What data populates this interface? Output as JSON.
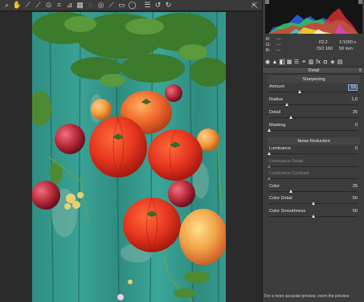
{
  "toolbar": {
    "tools": [
      "zoom-tool-icon",
      "hand-tool-icon",
      "white-balance-tool-icon",
      "color-sampler-icon",
      "targeted-adjustment-icon",
      "crop-tool-icon",
      "straighten-tool-icon",
      "transform-tool-icon",
      "spot-removal-icon",
      "red-eye-icon",
      "adjustment-brush-icon",
      "graduated-filter-icon",
      "radial-filter-icon",
      "preferences-icon",
      "rotate-left-icon",
      "rotate-right-icon"
    ],
    "glyphs": [
      "⌕",
      "✋",
      "⟋",
      "⟋",
      "⊙",
      "⌗",
      "⊿",
      "▦",
      "◌",
      "◎",
      "⟋",
      "▭",
      "◯",
      "☰",
      "↺",
      "↻"
    ],
    "fullscreen_glyph": "⇱"
  },
  "readout": {
    "r_label": "R:",
    "g_label": "G:",
    "b_label": "B:",
    "r_value": "---",
    "g_value": "---",
    "b_value": "---",
    "aperture": "f/2,2",
    "shutter": "1/1000 s",
    "iso": "ISO 160",
    "focal": "50 mm"
  },
  "panel_icons": [
    "◉",
    "▲",
    "◧",
    "▦",
    "☰",
    "≡",
    "▥",
    "fx",
    "◘",
    "◈",
    "▤"
  ],
  "detail": {
    "title": "Detail",
    "menu_glyph": "≡",
    "sharpening_title": "Sharpening",
    "sharpening": [
      {
        "label": "Amount",
        "value": "53",
        "pos": 0.35,
        "boxed": true
      },
      {
        "label": "Radius",
        "value": "1,0",
        "pos": 0.2
      },
      {
        "label": "Detail",
        "value": "25",
        "pos": 0.25
      },
      {
        "label": "Masking",
        "value": "0",
        "pos": 0.0
      }
    ],
    "noise_title": "Noise Reduction",
    "noise": [
      {
        "label": "Luminance",
        "value": "0",
        "pos": 0.0
      },
      {
        "label": "Luminance Detail",
        "value": "",
        "pos": 0.0,
        "dim": true
      },
      {
        "label": "Luminance Contrast",
        "value": "",
        "pos": 0.0,
        "dim": true
      },
      {
        "label": "Color",
        "value": "25",
        "pos": 0.25
      },
      {
        "label": "Color Detail",
        "value": "50",
        "pos": 0.5
      },
      {
        "label": "Color Smoothness",
        "value": "50",
        "pos": 0.5
      }
    ]
  },
  "hint": "For a more accurate preview, zoom the preview"
}
